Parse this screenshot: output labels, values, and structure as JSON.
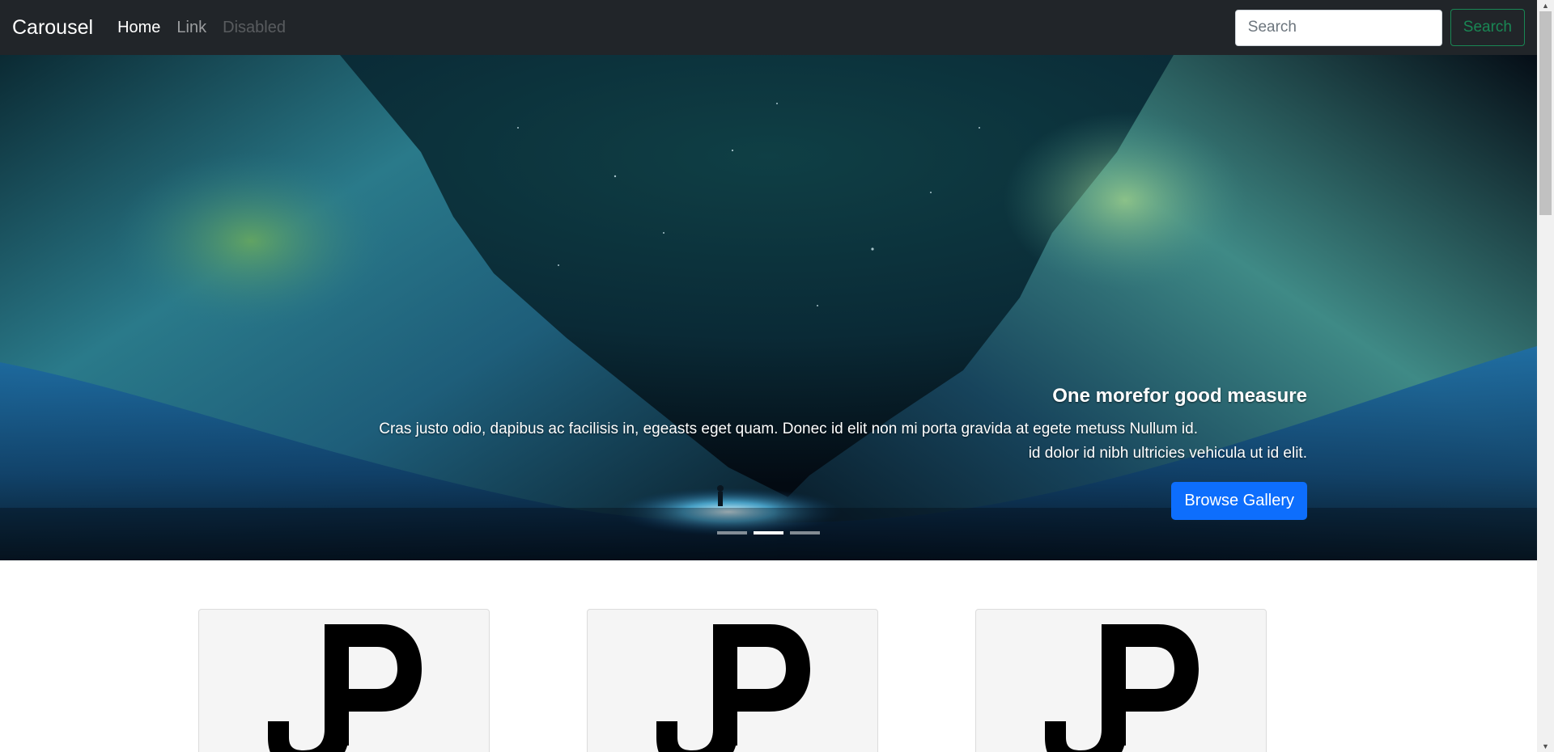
{
  "navbar": {
    "brand": "Carousel",
    "links": [
      {
        "label": "Home",
        "state": "active"
      },
      {
        "label": "Link",
        "state": "normal"
      },
      {
        "label": "Disabled",
        "state": "disabled"
      }
    ],
    "search": {
      "placeholder": "Search",
      "value": "",
      "button_label": "Search"
    }
  },
  "carousel": {
    "caption": {
      "title": "One morefor good measure",
      "text_line1": "Cras justo odio, dapibus ac facilisis in, egeasts eget quam. Donec id elit non mi porta gravida at egete metuss Nullum id.",
      "text_line2": "id dolor id nibh ultricies vehicula ut id elit.",
      "button_label": "Browse Gallery"
    },
    "indicators": {
      "count": 3,
      "active_index": 1
    }
  },
  "cards": [
    {
      "logo": "jp-world-logo",
      "logo_text": "JP WORLD"
    },
    {
      "logo": "jp-world-logo",
      "logo_text": "JP WORLD"
    },
    {
      "logo": "jp-world-logo",
      "logo_text": "JP WORLD"
    }
  ],
  "colors": {
    "navbar_bg": "#212529",
    "primary": "#0d6efd",
    "success": "#198754",
    "card_bg": "#f5f5f5"
  }
}
